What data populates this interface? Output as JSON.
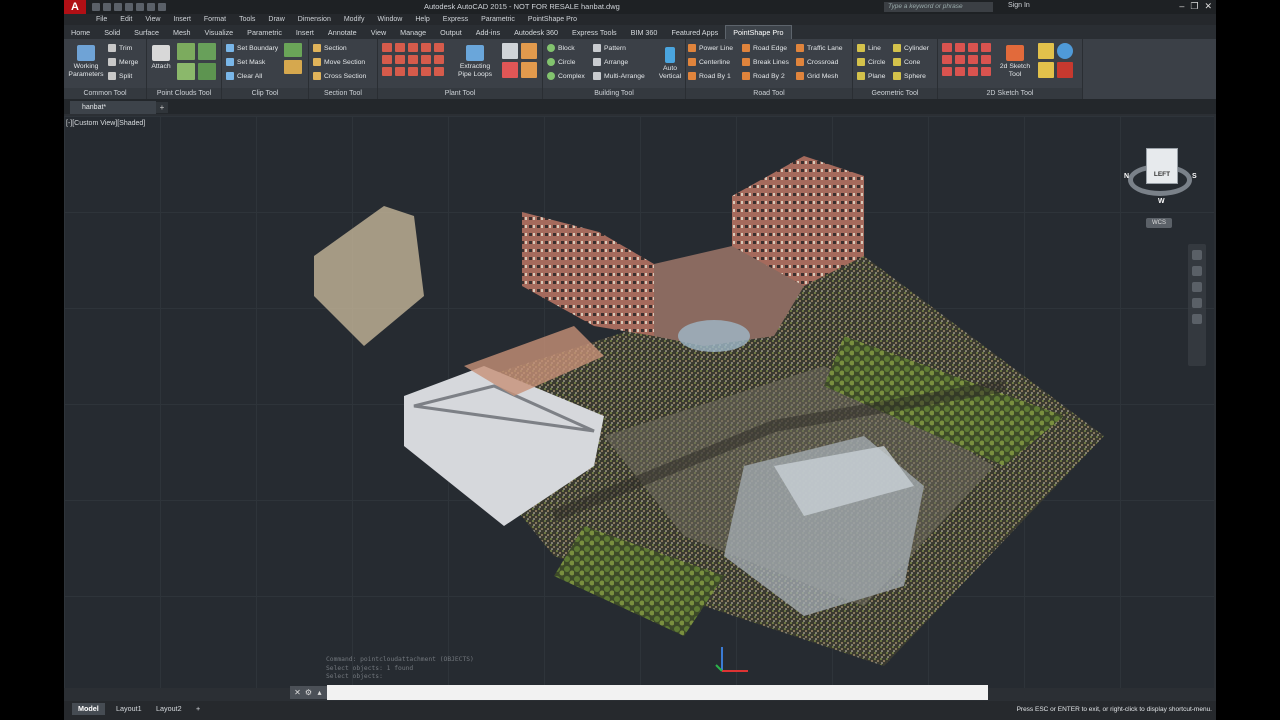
{
  "titlebar": {
    "app_logo": "A",
    "title": "Autodesk AutoCAD 2015 - NOT FOR RESALE    hanbat.dwg",
    "search_placeholder": "Type a keyword or phrase",
    "signin_label": "Sign In"
  },
  "menubar": [
    "File",
    "Edit",
    "View",
    "Insert",
    "Format",
    "Tools",
    "Draw",
    "Dimension",
    "Modify",
    "Window",
    "Help",
    "Express",
    "Parametric",
    "PointShape Pro"
  ],
  "ribbon_tabs": [
    "Home",
    "Solid",
    "Surface",
    "Mesh",
    "Visualize",
    "Parametric",
    "Insert",
    "Annotate",
    "View",
    "Manage",
    "Output",
    "Add-ins",
    "Autodesk 360",
    "Express Tools",
    "BIM 360",
    "Featured Apps",
    "PointShape Pro"
  ],
  "active_tab": "PointShape Pro",
  "panels": {
    "common": {
      "title": "Common Tool",
      "working": "Working Parameters",
      "trim": "Trim",
      "merge": "Merge",
      "split": "Split"
    },
    "pointclouds": {
      "title": "Point Clouds Tool",
      "attach": "Attach"
    },
    "clip": {
      "title": "Clip Tool",
      "set_boundary": "Set Boundary",
      "set_mask": "Set Mask",
      "clear_all": "Clear All"
    },
    "section": {
      "title": "Section Tool",
      "section": "Section",
      "move_section": "Move Section",
      "cross_section": "Cross Section"
    },
    "plant": {
      "title": "Plant Tool",
      "extracting": "Extracting Pipe Loops"
    },
    "building": {
      "title": "Building Tool",
      "block": "Block",
      "circle": "Circle",
      "complex": "Complex",
      "pattern": "Pattern",
      "arrange": "Arrange",
      "multi_arrange": "Multi-Arrange",
      "auto_vertical": "Auto Vertical"
    },
    "road": {
      "title": "Road Tool",
      "power_line": "Power Line",
      "centerline": "Centerline",
      "road_by_1": "Road By 1",
      "road_edge": "Road Edge",
      "break_lines": "Break Lines",
      "road_by_2": "Road By 2",
      "traffic_lane": "Traffic Lane",
      "crossroad": "Crossroad",
      "grid_mesh": "Grid Mesh"
    },
    "geometric": {
      "title": "Geometric Tool",
      "line": "Line",
      "circle": "Circle",
      "plane": "Plane",
      "cylinder": "Cylinder",
      "cone": "Cone",
      "sphere": "Sphere"
    },
    "sketch2d": {
      "title": "2D Sketch Tool",
      "sketch": "2d Sketch Tool"
    }
  },
  "file_tab": "hanbat*",
  "viewport_label": "[-][Custom View][Shaded]",
  "viewcube": {
    "face": "LEFT",
    "n": "N",
    "s": "S",
    "w": "W",
    "wcs": "WCS"
  },
  "command_history": [
    "Command: pointcloudattachment (OBJECTS)",
    "Select objects:  1 found",
    "Select objects:"
  ],
  "layout_tabs": [
    "Model",
    "Layout1",
    "Layout2"
  ],
  "status_message": "Press ESC or ENTER to exit, or right-click to display shortcut-menu.",
  "colors": {
    "accent": "#b10f15",
    "viewport_bg": "#262b31",
    "ribbon_bg": "#3b4047"
  }
}
